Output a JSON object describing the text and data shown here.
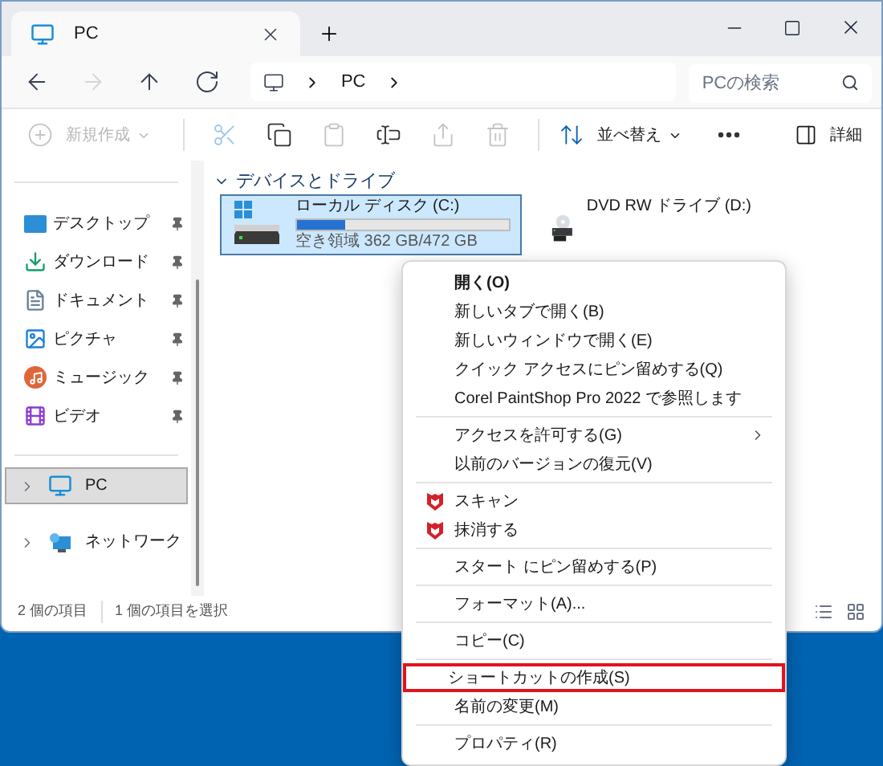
{
  "window": {
    "tab_title": "PC"
  },
  "address": {
    "segments": [
      "PC"
    ],
    "search_placeholder": "PCの検索"
  },
  "nav": [
    {
      "kind": "back",
      "disabled": false
    },
    {
      "kind": "forward",
      "disabled": true
    },
    {
      "kind": "up",
      "disabled": false
    },
    {
      "kind": "refresh",
      "disabled": false
    }
  ],
  "toolbar": [
    {
      "kind": "new",
      "label": "新規作成",
      "disabled": true
    },
    {
      "kind": "cut",
      "disabled": true
    },
    {
      "kind": "copy",
      "disabled": false
    },
    {
      "kind": "paste",
      "disabled": true
    },
    {
      "kind": "rename",
      "disabled": false
    },
    {
      "kind": "share",
      "disabled": true
    },
    {
      "kind": "delete",
      "disabled": true
    },
    {
      "kind": "sort",
      "label": "並べ替え",
      "disabled": false
    },
    {
      "kind": "more",
      "disabled": false
    }
  ],
  "details_button": "詳細",
  "sidebar": {
    "pinned": [
      {
        "kind": "desktop",
        "label": "デスクトップ",
        "pinned": true
      },
      {
        "kind": "download",
        "label": "ダウンロード",
        "pinned": true
      },
      {
        "kind": "documents",
        "label": "ドキュメント",
        "pinned": true
      },
      {
        "kind": "pictures",
        "label": "ピクチャ",
        "pinned": true
      },
      {
        "kind": "music",
        "label": "ミュージック",
        "pinned": true
      },
      {
        "kind": "video",
        "label": "ビデオ",
        "pinned": true
      }
    ],
    "tree": [
      {
        "kind": "pc",
        "label": "PC",
        "selected": true
      },
      {
        "kind": "network",
        "label": "ネットワーク",
        "selected": false
      }
    ]
  },
  "section": {
    "title": "デバイスとドライブ",
    "expanded": true
  },
  "drives": [
    {
      "kind": "disk",
      "name": "ローカル ディスク (C:)",
      "level": 0.23,
      "free": "空き領域 362 GB/472 GB",
      "selected": true
    },
    {
      "kind": "dvd",
      "name": "DVD RW ドライブ (D:)",
      "selected": false
    }
  ],
  "status_bar": [
    "2 個の項目",
    "1 個の項目を選択"
  ],
  "context_menu": [
    [
      {
        "kind": "default",
        "label": "開く(O)",
        "highlighted": false
      },
      {
        "kind": "item",
        "label": "新しいタブで開く(B)",
        "highlighted": false
      },
      {
        "kind": "item",
        "label": "新しいウィンドウで開く(E)",
        "highlighted": false
      },
      {
        "kind": "item",
        "label": "クイック アクセスにピン留めする(Q)",
        "highlighted": false
      },
      {
        "kind": "item",
        "label": "Corel PaintShop Pro 2022 で参照します",
        "highlighted": false
      }
    ],
    [
      {
        "kind": "submenu",
        "label": "アクセスを許可する(G)",
        "highlighted": false
      },
      {
        "kind": "item",
        "label": "以前のバージョンの復元(V)",
        "highlighted": false
      }
    ],
    [
      {
        "kind": "security",
        "label": "スキャン",
        "highlighted": false
      },
      {
        "kind": "security",
        "label": "抹消する",
        "highlighted": false
      }
    ],
    [
      {
        "kind": "item",
        "label": "スタート にピン留めする(P)",
        "highlighted": false
      }
    ],
    [
      {
        "kind": "item",
        "label": "フォーマット(A)...",
        "highlighted": false
      }
    ],
    [
      {
        "kind": "item",
        "label": "コピー(C)",
        "highlighted": false
      }
    ],
    [
      {
        "kind": "item",
        "label": "ショートカットの作成(S)",
        "highlighted": true
      },
      {
        "kind": "item",
        "label": "名前の変更(M)",
        "highlighted": false
      }
    ],
    [
      {
        "kind": "item",
        "label": "プロパティ(R)",
        "highlighted": false
      }
    ]
  ]
}
